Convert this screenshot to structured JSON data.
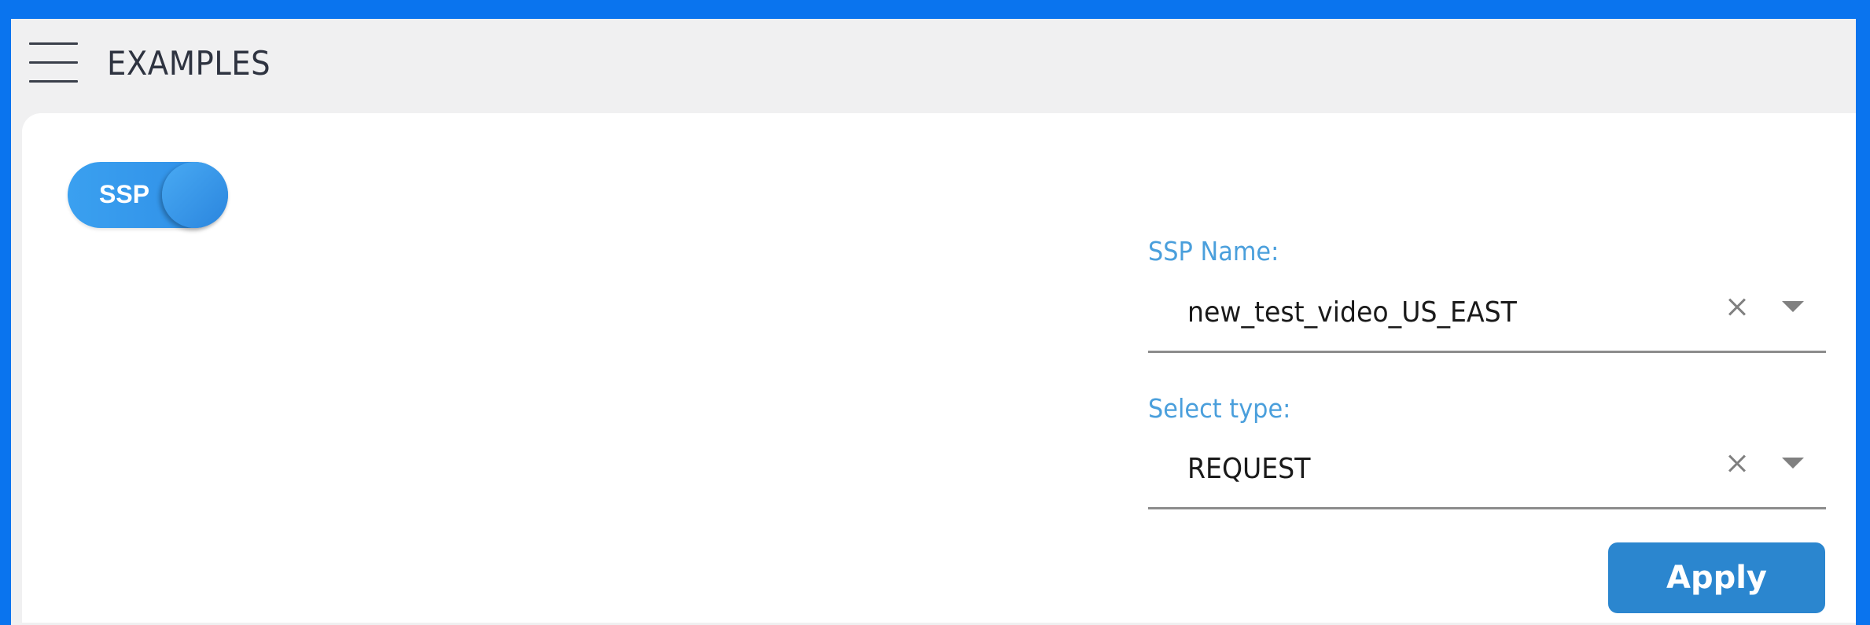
{
  "header": {
    "title": "EXAMPLES",
    "menu_icon": "hamburger-menu-icon"
  },
  "toggle": {
    "label": "SSP",
    "state": "on",
    "color": "#2f8ee6"
  },
  "form": {
    "ssp_name": {
      "label": "SSP Name:",
      "value": "new_test_video_US_EAST"
    },
    "select_type": {
      "label": "Select type:",
      "value": "REQUEST"
    },
    "apply_label": "Apply"
  },
  "colors": {
    "frame": "#0a74ee",
    "label_accent": "#4a9fdc",
    "button": "#2b86cf"
  }
}
